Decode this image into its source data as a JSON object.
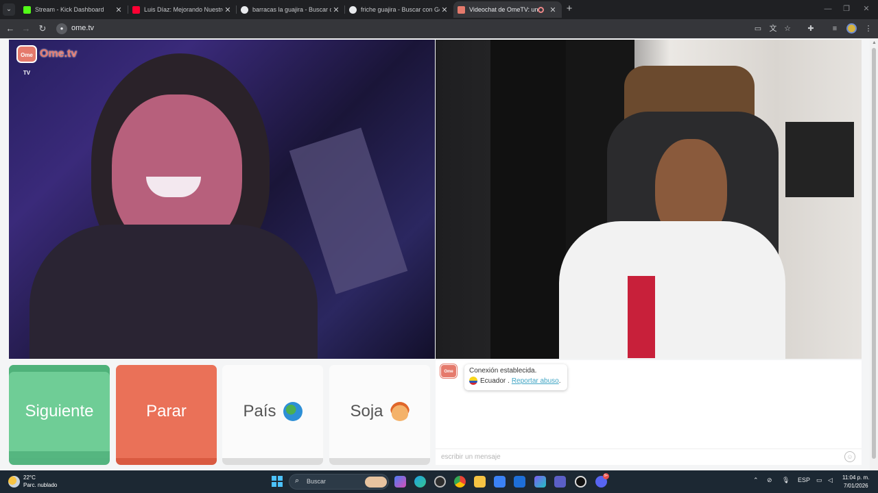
{
  "browser": {
    "tabs": [
      {
        "title": "Stream - Kick Dashboard",
        "favicon_color": "#53fc18"
      },
      {
        "title": "Luis Díaz: Mejorando Nuestro Ni",
        "favicon_color": "#ff0033"
      },
      {
        "title": "barracas la guajira - Buscar con",
        "favicon_color": "#e8eaed"
      },
      {
        "title": "friche guajira - Buscar con Goog",
        "favicon_color": "#e8eaed"
      },
      {
        "title": "Videochat de OmeTV: una a",
        "favicon_color": "#e57a6c",
        "active": true
      }
    ],
    "new_tab": "+",
    "url": "ome.tv",
    "window_controls": [
      "—",
      "❐",
      "✕"
    ]
  },
  "site": {
    "logo_badge": "Ome TV",
    "logo_text": "Ome.tv",
    "accent": "#e57a6c"
  },
  "buttons": {
    "next": "Siguiente",
    "stop": "Parar",
    "country": "País",
    "gender": "Soja"
  },
  "chat": {
    "logo_badge": "Ome TV",
    "status": "Conexión establecida.",
    "country": "Ecuador .",
    "report": "Reportar abuso",
    "report_suffix": ".",
    "input_placeholder": "escribir un mensaje"
  },
  "taskbar": {
    "temperature": "22°C",
    "weather": "Parc. nublado",
    "search": "Buscar",
    "language": "ESP",
    "time": "11:04 p. m.",
    "date": "7/01/2026",
    "discord_badge": "9+"
  }
}
